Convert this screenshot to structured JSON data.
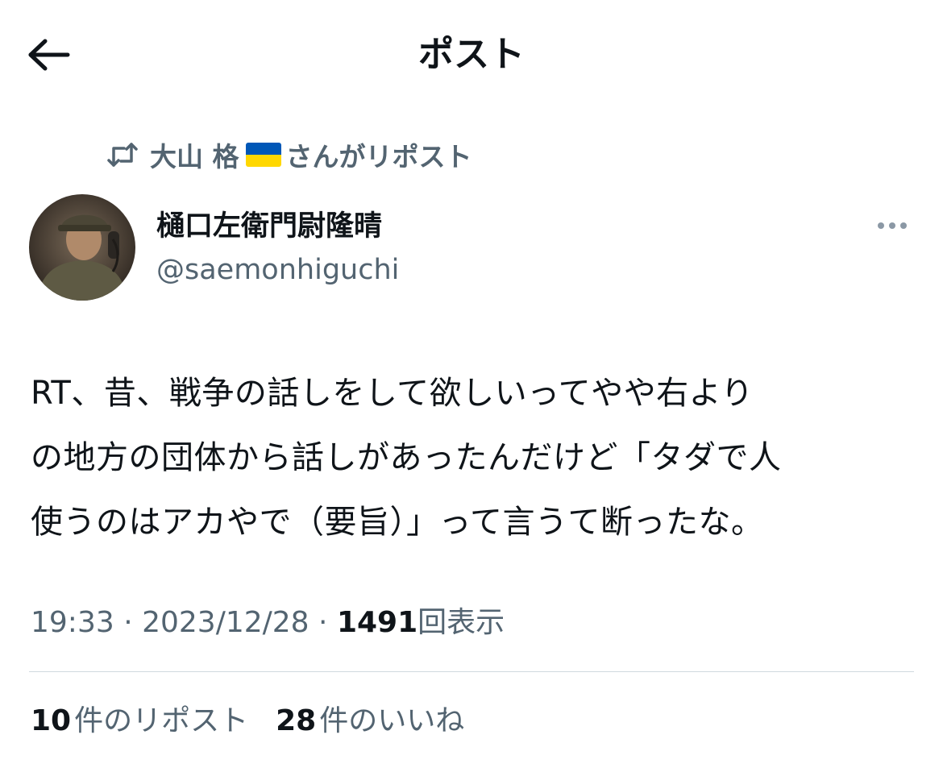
{
  "header": {
    "title": "ポスト",
    "back_icon": "arrow-left-icon"
  },
  "repost_banner": {
    "icon": "repost-icon",
    "name": "大山 格",
    "flag": "ukraine-flag",
    "suffix": "さんがリポスト"
  },
  "author": {
    "display_name": "樋口左衛門尉隆晴",
    "handle": "@saemonhiguchi"
  },
  "tweet": {
    "lines": [
      "RT、昔、戦争の話しをして欲しいってやや右より",
      "の地方の団体から話しがあったんだけど「タダで人",
      "使うのはアカやで（要旨）」って言うて断ったな。"
    ]
  },
  "meta": {
    "time": "19:33",
    "separator": " · ",
    "date": "2023/12/28",
    "views_count": "1491",
    "views_label": "回表示"
  },
  "stats": {
    "reposts_count": "10",
    "reposts_label": "件のリポスト",
    "likes_count": "28",
    "likes_label": "件のいいね"
  },
  "colors": {
    "text_primary": "#0f1419",
    "text_secondary": "#536471",
    "divider": "#cfd9de",
    "flag_blue": "#0057b7",
    "flag_yellow": "#ffd700"
  }
}
